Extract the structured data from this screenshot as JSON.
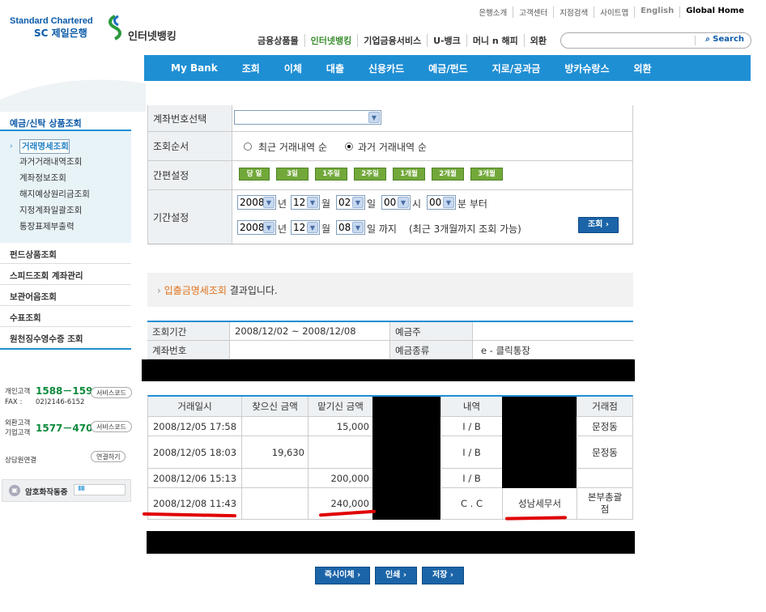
{
  "brand": {
    "line1": "Standard Chartered",
    "line2": "SC 제일은행",
    "service": "인터넷뱅킹"
  },
  "util_links": [
    "은행소개",
    "고객센터",
    "지점검색",
    "사이트맵",
    "English",
    "Global Home"
  ],
  "top_nav": [
    "금융상품몰",
    "인터넷뱅킹",
    "기업금융서비스",
    "U-뱅크",
    "머니 n 해피",
    "외환"
  ],
  "search": {
    "button": "Search"
  },
  "main_nav": [
    "My Bank",
    "조회",
    "이체",
    "대출",
    "신용카드",
    "예금/펀드",
    "지로/공과금",
    "방카슈랑스",
    "외환"
  ],
  "sidebar": {
    "title": "예금/신탁 상품조회",
    "sub_items": [
      "거래명세조회",
      "과거거래내역조회",
      "계좌정보조회",
      "해지예상원리금조회",
      "지정계좌일괄조회",
      "통장표제부출력"
    ],
    "items": [
      "펀드상품조회",
      "스피드조회 계좌관리",
      "보관어음조회",
      "수표조회",
      "원천징수영수증 조회"
    ],
    "contact": {
      "personal_label_1": "개인고객",
      "personal_phone": "1588－1599",
      "fax_label": "FAX :",
      "fax": "02)2146-6152",
      "corp_label_1": "외환고객",
      "corp_label_2": "기업고객",
      "corp_phone": "1577－4700",
      "service_code": "서비스코드",
      "consult": "상담원연결",
      "connect": "연결하기"
    },
    "lock_text": "암호화작동중",
    "lock_bar": "IIIIII"
  },
  "form": {
    "account_label": "계좌번호선택",
    "order_label": "조회순서",
    "order_opt1": "최근 거래내역 순",
    "order_opt2": "과거 거래내역 순",
    "quick_label": "간편설정",
    "quick_buttons": [
      "당 일",
      "3일",
      "1주일",
      "2주일",
      "1개월",
      "2개월",
      "3개월"
    ],
    "period_label": "기간설정",
    "from": {
      "year": "2008",
      "month": "12",
      "day": "02",
      "hour": "00",
      "min": "00"
    },
    "to": {
      "year": "2008",
      "month": "12",
      "day": "08"
    },
    "u_year": "년",
    "u_month": "월",
    "u_day": "일",
    "u_hour": "시",
    "u_min": "분 부터",
    "to_suffix": "일 까지",
    "note": "(최근 3개월까지 조회 가능)",
    "submit": "조회"
  },
  "result": {
    "prefix": "›",
    "highlight": "입출금명세조회",
    "text": " 결과입니다."
  },
  "info": {
    "period_label": "조회기간",
    "period": "2008/12/02 ~ 2008/12/08",
    "holder_label": "예금주",
    "holder": "",
    "account_label": "계좌번호",
    "account": "",
    "type_label": "예금종류",
    "type": "e - 클릭통장"
  },
  "transactions": {
    "headers": [
      "거래일시",
      "찾으신 금액",
      "맡기신 금액",
      "",
      "내역",
      "",
      "거래점"
    ],
    "rows": [
      {
        "date": "2008/12/05 17:58",
        "withdraw": "",
        "deposit": "15,000",
        "type": "I / B",
        "memo": "",
        "branch": "문정동"
      },
      {
        "date": "2008/12/05 18:03",
        "withdraw": "19,630",
        "deposit": "",
        "type": "I / B",
        "memo": "",
        "branch": "문정동"
      },
      {
        "date": "2008/12/06 15:13",
        "withdraw": "",
        "deposit": "200,000",
        "type": "I / B",
        "memo": "",
        "branch": ""
      },
      {
        "date": "2008/12/08 11:43",
        "withdraw": "",
        "deposit": "240,000",
        "type": "C . C",
        "memo": "성남세무서",
        "branch_1": "본부총괄",
        "branch_2": "점"
      }
    ]
  },
  "bottom_buttons": [
    "즉시이체",
    "인쇄",
    "저장"
  ],
  "colors": {
    "nav": "#1f8fd4",
    "green": "#3a8e2e",
    "accent": "#e0731f",
    "button": "#1b64a8"
  }
}
